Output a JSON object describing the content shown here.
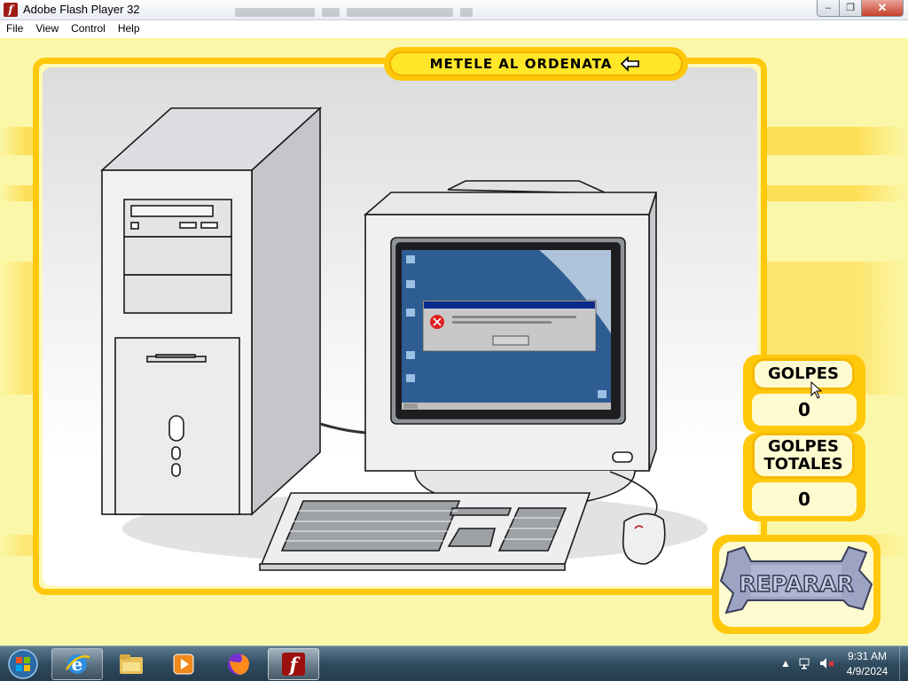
{
  "window": {
    "title": "Adobe Flash Player 32",
    "app_icon": "flash-icon",
    "controls": {
      "minimize": "–",
      "maximize": "❐",
      "close": "✕"
    }
  },
  "menu": {
    "items": [
      "File",
      "View",
      "Control",
      "Help"
    ]
  },
  "game": {
    "title": "METELE AL ORDENATA",
    "counters": {
      "hits_label": "GOLPES",
      "hits_value": "0",
      "total_label_line1": "GOLPES",
      "total_label_line2": "TOTALES",
      "total_value": "0"
    },
    "repair_label": "REPARAR",
    "colors": {
      "frame": "#ffc80a",
      "panel": "#fffbd0",
      "screen": "#2d5d93",
      "dialog_title": "#0b2a8a"
    }
  },
  "taskbar": {
    "apps": [
      "internet-explorer-icon",
      "file-explorer-icon",
      "media-player-icon",
      "firefox-icon",
      "flash-player-icon"
    ],
    "tray": {
      "time": "9:31 AM",
      "date": "4/9/2024"
    }
  }
}
